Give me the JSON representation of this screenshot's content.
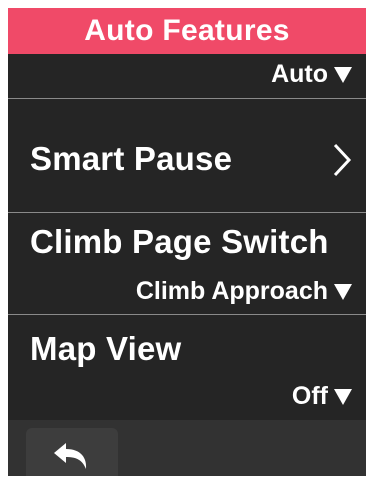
{
  "header": {
    "title": "Auto Features"
  },
  "auto_row": {
    "value": "Auto"
  },
  "smart_pause": {
    "label": "Smart Pause"
  },
  "climb_page_switch": {
    "label": "Climb Page Switch",
    "value": "Climb Approach"
  },
  "map_view": {
    "label": "Map View",
    "value": "Off"
  },
  "footer": {
    "back_icon": "back-arrow-icon"
  },
  "colors": {
    "accent": "#f04a68",
    "background": "#252525",
    "footer": "#323232"
  }
}
